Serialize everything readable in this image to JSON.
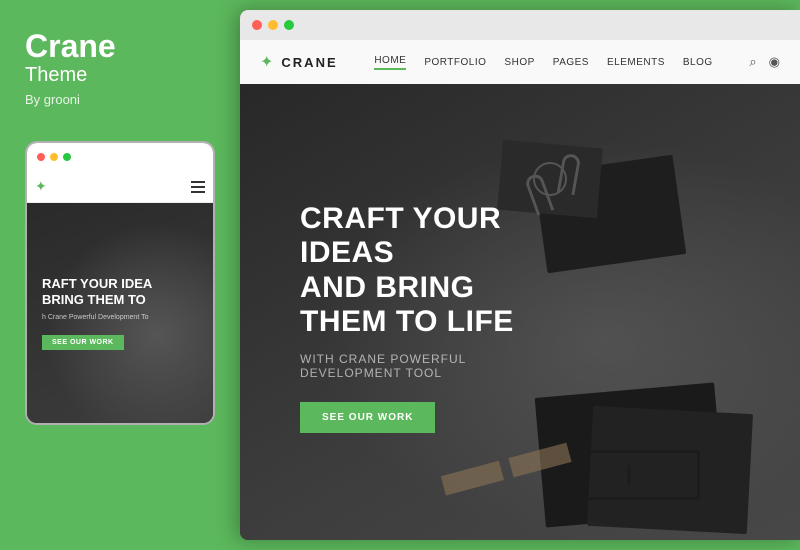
{
  "sidebar": {
    "theme_name": "Crane",
    "theme_sub": "Theme",
    "theme_author": "By grooni",
    "accent_color": "#5cb85c"
  },
  "mobile": {
    "hero_title_line1": "RAFT YOUR IDEA",
    "hero_title_line2": "BRING THEM TO",
    "hero_sub": "h Crane Powerful Development To",
    "cta_label": "SEE OUR WORK"
  },
  "desktop": {
    "browser_dots": [
      "red",
      "yellow",
      "green"
    ],
    "nav": {
      "brand": "CRANE",
      "menu_items": [
        "HOME",
        "PORTFOLIO",
        "SHOP",
        "PAGES",
        "ELEMENTS",
        "BLOG"
      ],
      "active_item": "HOME"
    },
    "hero": {
      "title_line1": "CRAFT YOUR IDEAS",
      "title_line2": "AND BRING THEM TO LIFE",
      "subtitle": "With Crane Powerful Development Tool",
      "cta_label": "SEE OUR WORK"
    }
  }
}
